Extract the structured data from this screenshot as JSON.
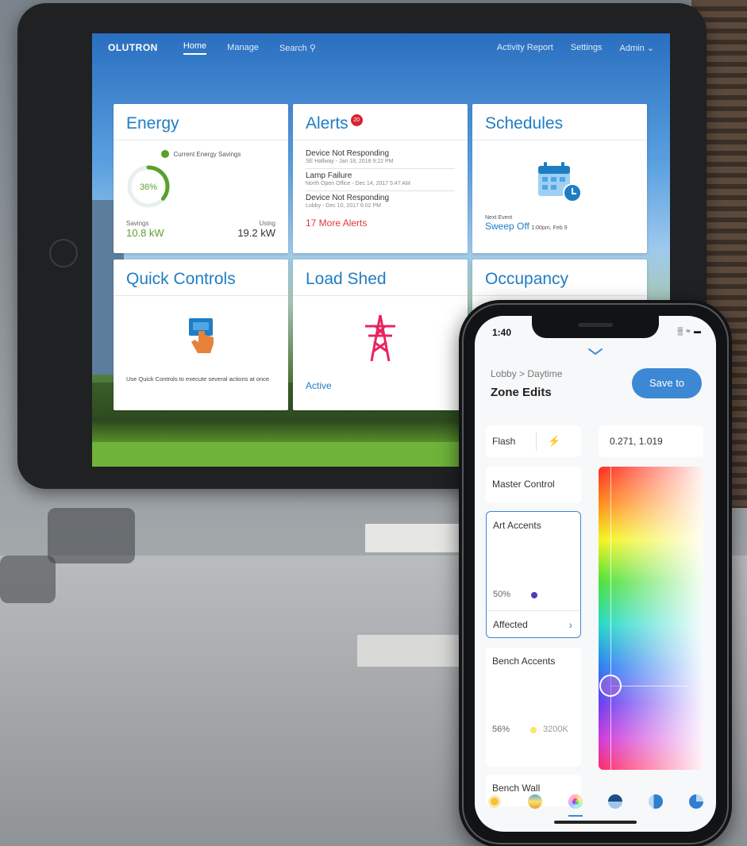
{
  "tablet": {
    "nav": {
      "logo": "OLUTRON",
      "links": [
        "Home",
        "Manage",
        "Search"
      ],
      "right_links": [
        "Activity Report",
        "Settings",
        "Admin"
      ]
    },
    "energy": {
      "title": "Energy",
      "legend": "Current Energy Savings",
      "percent": "36%",
      "percent_value": 36,
      "savings_label": "Savings",
      "savings_value": "10.8 kW",
      "using_label": "Using",
      "using_value": "19.2 kW"
    },
    "alerts": {
      "title": "Alerts",
      "badge": "20",
      "items": [
        {
          "title": "Device Not Responding",
          "sub": "SE Hallway - Jan 18, 2018 9:22 PM"
        },
        {
          "title": "Lamp Failure",
          "sub": "North Open Office - Dec 14, 2017 5:47 AM"
        },
        {
          "title": "Device Not Responding",
          "sub": "Lobby - Dec 10, 2017 6:02 PM"
        }
      ],
      "more": "17 More Alerts"
    },
    "schedules": {
      "title": "Schedules",
      "next_label": "Next Event",
      "next_event": "Sweep Off",
      "next_time": "1:00pm, Feb 9"
    },
    "quick_controls": {
      "title": "Quick Controls",
      "description": "Use Quick Controls to execute several actions at once"
    },
    "load_shed": {
      "title": "Load Shed",
      "status": "Active"
    },
    "occupancy": {
      "title": "Occupancy"
    }
  },
  "phone": {
    "status_time": "1:40",
    "breadcrumb": "Lobby > Daytime",
    "title": "Zone Edits",
    "save_button": "Save to",
    "flash_label": "Flash",
    "color_coordinates": "0.271, 1.019",
    "zones": [
      {
        "name": "Master Control"
      },
      {
        "name": "Art Accents",
        "level": "50%",
        "affected": "Affected"
      },
      {
        "name": "Bench Accents",
        "level": "56%",
        "kelvin": "3200K"
      },
      {
        "name": "Bench Wall"
      }
    ]
  },
  "colors": {
    "lutron_blue": "#1f7dc4",
    "save_blue": "#3d88d4",
    "alert_red": "#e2353f",
    "energy_green": "#5aa02c",
    "load_shed_pink": "#e8245f"
  }
}
